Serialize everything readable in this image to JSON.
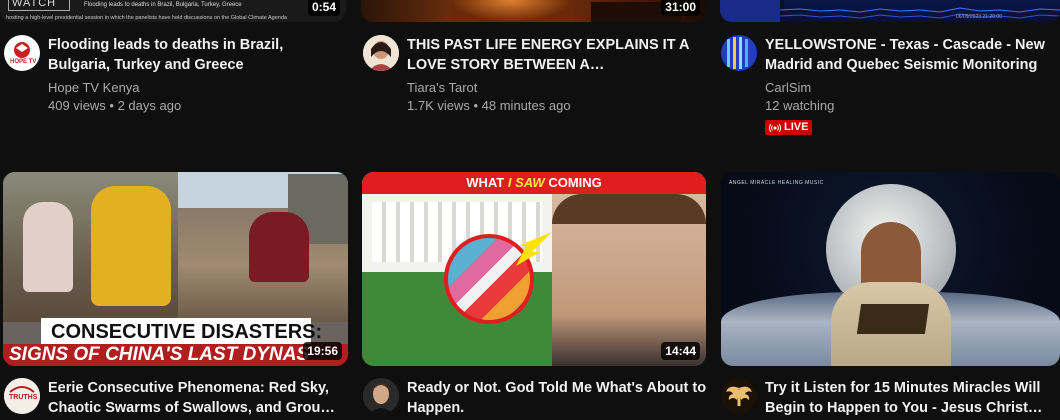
{
  "videos": [
    {
      "title": "Flooding leads to deaths in Brazil, Bulgaria, Turkey and Greece",
      "channel": "Hope TV Kenya",
      "views": "409 views",
      "age": "2 days ago",
      "duration": "0:54",
      "thumb_text_watch": "WATCH",
      "thumb_caption_1": "Flooding leads to deaths in Brazil, Bulgaria, Turkey, Greece",
      "thumb_caption_2": "hosting a high-level presidential session in which the panelists have held discussions on the Global Climate Agenda",
      "avatar_text": "HOPE TV",
      "avatar_color": "#c81e1e"
    },
    {
      "title": "THIS PAST LIFE ENERGY EXPLAINS IT A LOVE STORY BETWEEN A…",
      "channel": "Tiara's Tarot",
      "views": "1.7K views",
      "age": "48 minutes ago",
      "duration": "31:00"
    },
    {
      "title": "YELLOWSTONE - Texas - Cascade - New Madrid and Quebec Seismic Monitoring",
      "channel": "CarlSim",
      "views": "12 watching",
      "live_label": "LIVE",
      "live_color": "#cc0000",
      "thumb_timestamp": "06/09/2023 21:20:00"
    },
    {
      "title": "Eerie Consecutive Phenomena: Red Sky, Chaotic Swarms of Swallows, and Grou…",
      "duration": "19:56",
      "thumb_headline_1": "CONSECUTIVE DISASTERS:",
      "thumb_headline_2": "SIGNS OF CHINA'S LAST DYNAS",
      "avatar_text": "TRUTHS"
    },
    {
      "title": "Ready or Not. God Told Me What's About to Happen.",
      "duration": "14:44",
      "thumb_banner_1": "WHAT ",
      "thumb_banner_2": "I SAW",
      "thumb_banner_3": " COMING"
    },
    {
      "title": "Try it Listen for 15 Minutes Miracles Will Begin to Happen to You - Jesus Christ…",
      "thumb_caption": "ANGEL MIRACLE HEALING MUSIC"
    }
  ],
  "separator": " • "
}
